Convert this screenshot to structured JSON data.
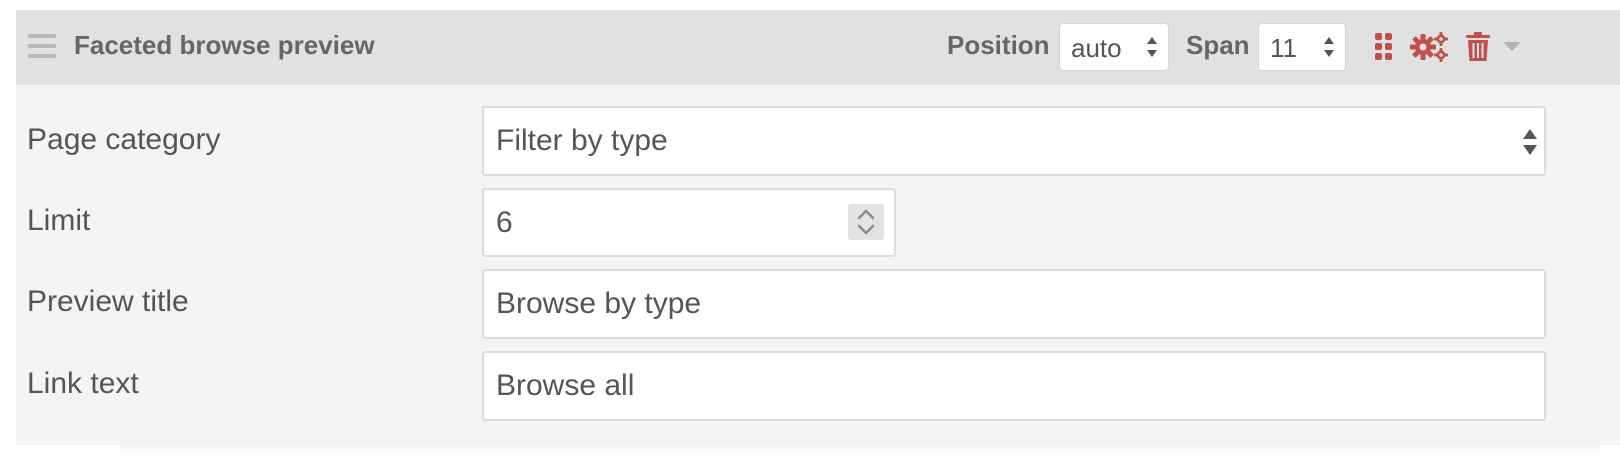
{
  "block": {
    "title": "Faceted browse preview",
    "position_label": "Position",
    "position_value": "auto",
    "span_label": "Span",
    "span_value": "11",
    "icons": [
      "drag-handle-icon",
      "grid-icon",
      "gears-icon",
      "trash-icon",
      "caret-down-icon"
    ],
    "icon_color": "#c0504d",
    "muted_icon_color": "#b3b3b3"
  },
  "form": {
    "page_category": {
      "label": "Page category",
      "value": "Filter by type"
    },
    "limit": {
      "label": "Limit",
      "value": "6"
    },
    "preview_title": {
      "label": "Preview title",
      "value": "Browse by type"
    },
    "link_text": {
      "label": "Link text",
      "value": "Browse all"
    }
  }
}
